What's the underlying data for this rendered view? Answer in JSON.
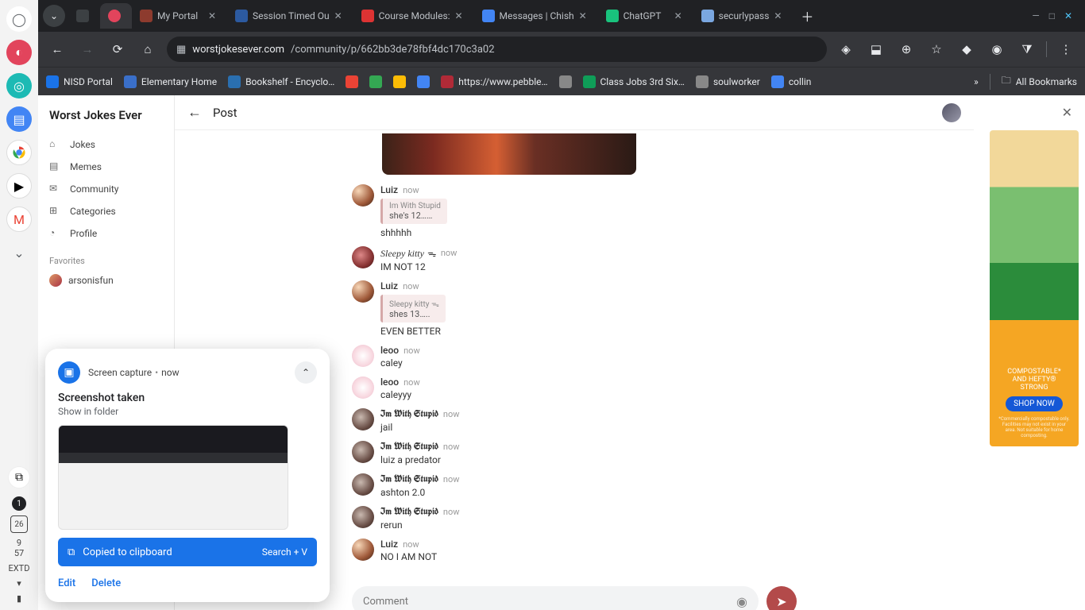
{
  "shelf": {
    "icons": [
      "launcher",
      "palette",
      "globe",
      "docs",
      "chrome",
      "play",
      "gmail",
      "expand"
    ],
    "status": {
      "badge": "1",
      "date": "26",
      "time_h": "9",
      "time_m": "57",
      "tz": "EXTD"
    }
  },
  "tabs": [
    {
      "label": "",
      "active": false,
      "favcolor": "#3c4043"
    },
    {
      "label": "My Portal",
      "active": false,
      "favcolor": "#8d3b2e"
    },
    {
      "label": "Session Timed Ou",
      "active": false,
      "favcolor": "#2c5aa0"
    },
    {
      "label": "Course Modules:",
      "active": false,
      "favcolor": "#d33"
    },
    {
      "label": "Messages | Chish",
      "active": false,
      "favcolor": "#4285f4"
    },
    {
      "label": "ChatGPT",
      "active": false,
      "favcolor": "#19c37d"
    },
    {
      "label": "securlypass",
      "active": false,
      "favcolor": "#7aa7e0"
    }
  ],
  "active_tab": {
    "label": "",
    "favcolor": "#e2445c"
  },
  "url": {
    "host": "worstjokesever.com",
    "path": "/community/p/662bb3de78fbf4dc170c3a02"
  },
  "bookmarks": [
    {
      "label": "NISD Portal",
      "favcolor": "#1a73e8"
    },
    {
      "label": "Elementary Home",
      "favcolor": "#3a6fc9"
    },
    {
      "label": "Bookshelf - Encyclo…",
      "favcolor": "#2a6fb0"
    },
    {
      "label": "",
      "favcolor": "#ea4335"
    },
    {
      "label": "",
      "favcolor": "#34a853"
    },
    {
      "label": "",
      "favcolor": "#fbbc05"
    },
    {
      "label": "",
      "favcolor": "#4285f4"
    },
    {
      "label": "https://www.pebble…",
      "favcolor": "#b02a37"
    },
    {
      "label": "",
      "favcolor": "#888"
    },
    {
      "label": "Class Jobs 3rd Six…",
      "favcolor": "#0f9d58"
    },
    {
      "label": "soulworker",
      "favcolor": "#888"
    },
    {
      "label": "collin",
      "favcolor": "#4285f4"
    }
  ],
  "bookmarks_overflow": "»",
  "all_bookmarks": "All Bookmarks",
  "sidebar": {
    "title": "Worst Jokes Ever",
    "items": [
      {
        "icon": "home",
        "label": "Jokes"
      },
      {
        "icon": "image",
        "label": "Memes"
      },
      {
        "icon": "chat",
        "label": "Community"
      },
      {
        "icon": "grid",
        "label": "Categories"
      },
      {
        "icon": "user",
        "label": "Profile"
      }
    ],
    "favorites_head": "Favorites",
    "favorites": [
      {
        "label": "arsonisfun"
      }
    ]
  },
  "post_header": {
    "title": "Post"
  },
  "comments": [
    {
      "ava": "luiz",
      "name": "Luiz",
      "fancy": false,
      "time": "now",
      "quote": {
        "name": "Im With Stupid",
        "text": "she's 12……"
      },
      "text": "shhhhh"
    },
    {
      "ava": "sleepy",
      "name": "Sleepy kitty ᯓ",
      "italic": true,
      "time": "now",
      "text": "IM NOT 12"
    },
    {
      "ava": "luiz",
      "name": "Luiz",
      "time": "now",
      "quote": {
        "name": "Sleepy kitty ᯓ",
        "text": "shes 13….."
      },
      "text": "EVEN BETTER"
    },
    {
      "ava": "leoo",
      "name": "leoo",
      "time": "now",
      "text": "caley"
    },
    {
      "ava": "leoo",
      "name": "leoo",
      "time": "now",
      "text": "caleyyy"
    },
    {
      "ava": "imw",
      "name": "Im With Stupid",
      "fancy": true,
      "time": "now",
      "text": "jail"
    },
    {
      "ava": "imw",
      "name": "Im With Stupid",
      "fancy": true,
      "time": "now",
      "text": "luiz a predator"
    },
    {
      "ava": "imw",
      "name": "Im With Stupid",
      "fancy": true,
      "time": "now",
      "text": "ashton 2.0"
    },
    {
      "ava": "imw",
      "name": "Im With Stupid",
      "fancy": true,
      "time": "now",
      "text": "rerun"
    },
    {
      "ava": "luiz",
      "name": "Luiz",
      "time": "now",
      "text": "NO I AM NOT"
    }
  ],
  "comment_placeholder": "Comment",
  "ad": {
    "line1": "COMPOSTABLE*",
    "line2": "AND HEFTY®",
    "line3": "STRONG",
    "cta": "SHOP NOW"
  },
  "notif": {
    "app": "Screen capture",
    "time": "now",
    "title": "Screenshot taken",
    "sub": "Show in folder",
    "copied": "Copied to clipboard",
    "shortcut": "Search + V",
    "edit": "Edit",
    "delete": "Delete"
  }
}
